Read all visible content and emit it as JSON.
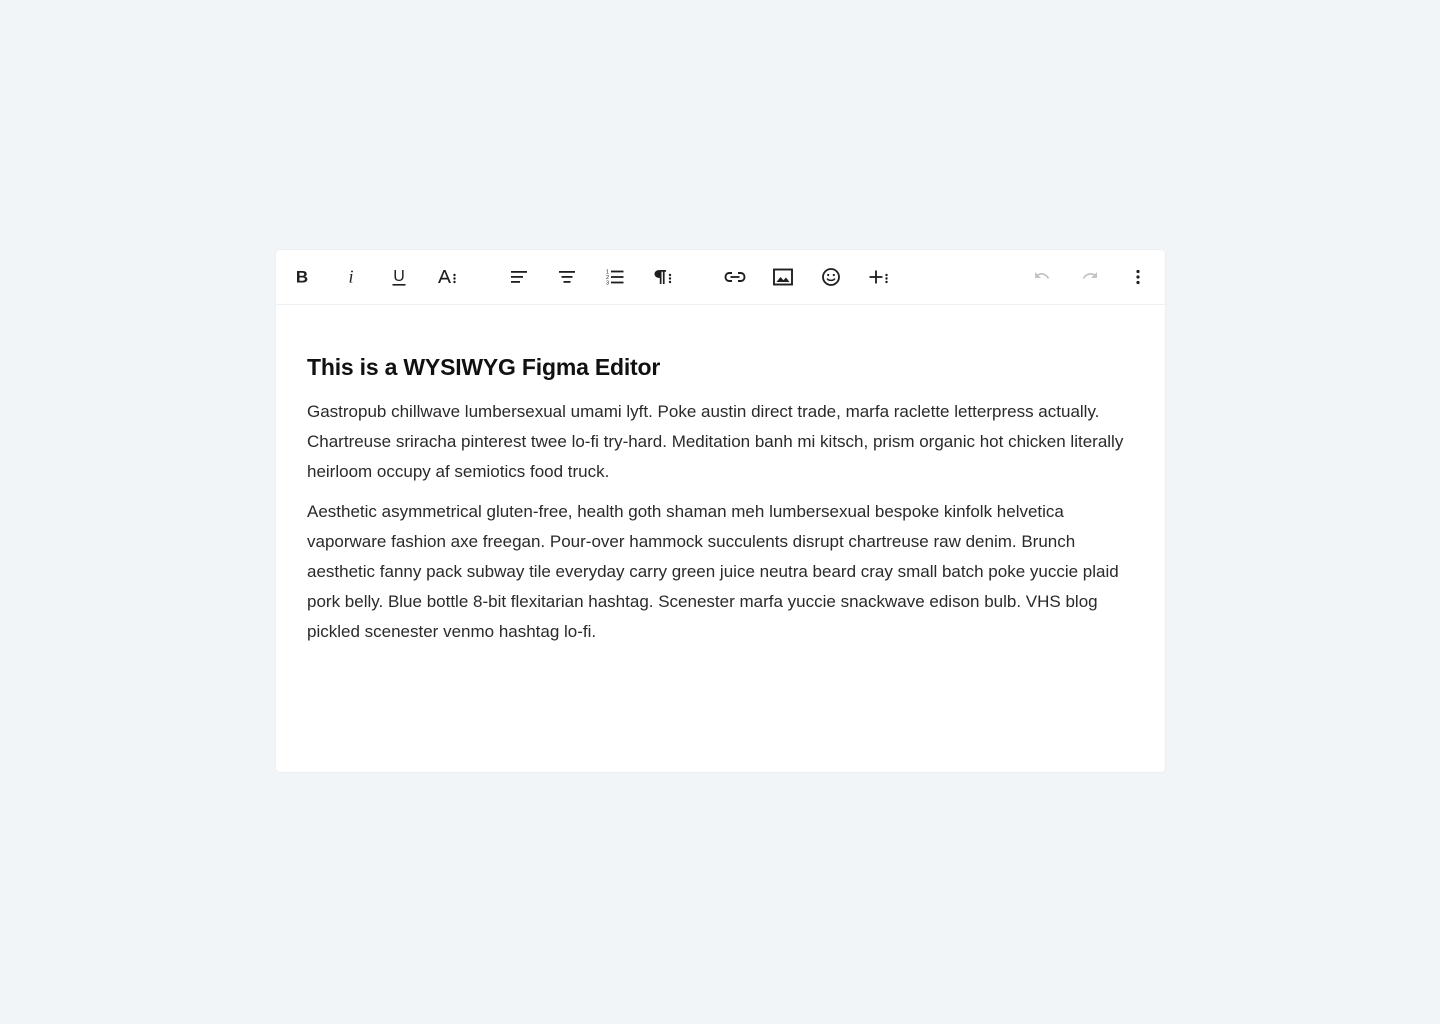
{
  "editor": {
    "toolbar": {
      "buttons": [
        {
          "icon": "bold-icon",
          "label": "B"
        },
        {
          "icon": "italic-icon",
          "label": "i"
        },
        {
          "icon": "underline-icon",
          "label": "U"
        },
        {
          "icon": "font-size-icon"
        },
        {
          "icon": "align-left-icon"
        },
        {
          "icon": "align-center-icon"
        },
        {
          "icon": "numbered-list-icon"
        },
        {
          "icon": "paragraph-icon"
        },
        {
          "icon": "link-icon"
        },
        {
          "icon": "image-icon"
        },
        {
          "icon": "emoji-icon"
        },
        {
          "icon": "insert-more-icon"
        },
        {
          "icon": "undo-icon",
          "state": "disabled"
        },
        {
          "icon": "redo-icon",
          "state": "disabled"
        },
        {
          "icon": "more-options-icon"
        }
      ]
    },
    "document": {
      "heading": "This is a WYSIWYG Figma Editor",
      "paragraphs": [
        "Gastropub chillwave lumbersexual umami lyft. Poke austin direct trade, marfa raclette letterpress actually. Chartreuse sriracha pinterest twee lo-fi try-hard. Meditation banh mi kitsch, prism organic hot chicken literally heirloom occupy af semiotics food truck.",
        "Aesthetic asymmetrical gluten-free, health goth shaman meh lumbersexual bespoke kinfolk helvetica vaporware fashion axe freegan. Pour-over hammock succulents disrupt chartreuse raw denim. Brunch aesthetic fanny pack subway tile everyday carry green juice neutra beard cray small batch poke yuccie plaid pork belly. Blue bottle 8-bit flexitarian hashtag. Scenester marfa yuccie snackwave edison bulb. VHS blog pickled scenester venmo hashtag lo-fi."
      ]
    }
  },
  "colors": {
    "page_background": "#f2f5f8",
    "editor_background": "#ffffff",
    "icon": "#1f1f1f",
    "icon_disabled": "#c4c4c4",
    "text": "#2a2a2a"
  }
}
